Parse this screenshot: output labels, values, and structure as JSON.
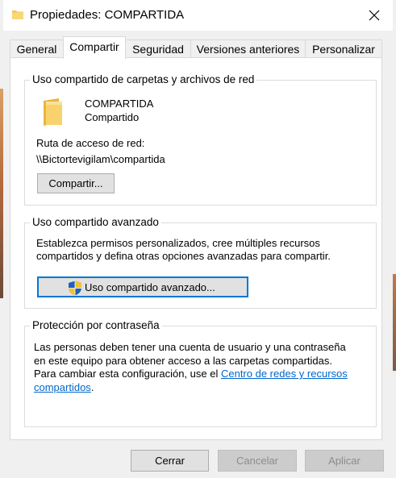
{
  "window": {
    "title": "Propiedades: COMPARTIDA"
  },
  "tabs": [
    {
      "label": "General"
    },
    {
      "label": "Compartir"
    },
    {
      "label": "Seguridad"
    },
    {
      "label": "Versiones anteriores"
    },
    {
      "label": "Personalizar"
    }
  ],
  "network_sharing": {
    "legend": "Uso compartido de carpetas y archivos de red",
    "folder_name": "COMPARTIDA",
    "folder_status": "Compartido",
    "path_label": "Ruta de acceso de red:",
    "path_value": "\\\\Bictortevigilam\\compartida",
    "share_button": "Compartir..."
  },
  "advanced_sharing": {
    "legend": "Uso compartido avanzado",
    "description_line1": "Establezca permisos personalizados, cree múltiples recursos",
    "description_line2": "compartidos y defina otras opciones avanzadas para compartir.",
    "button_label": "Uso compartido avanzado..."
  },
  "password_protection": {
    "legend": "Protección por contraseña",
    "line1": "Las personas deben tener una cuenta de usuario y una contraseña",
    "line2": "en este equipo para obtener acceso a las carpetas compartidas.",
    "line3_prefix": "Para cambiar esta configuración, use el ",
    "link_part1": "Centro de redes y recursos",
    "link_part2": "compartidos",
    "suffix": "."
  },
  "footer": {
    "close": "Cerrar",
    "cancel": "Cancelar",
    "apply": "Aplicar"
  },
  "colors": {
    "accent": "#0078d7",
    "link": "#0066cc",
    "folder": "#f3c55a"
  },
  "icons": {
    "title": "folder-icon",
    "close": "close-icon",
    "folder": "folder-icon",
    "shield": "uac-shield-icon"
  }
}
